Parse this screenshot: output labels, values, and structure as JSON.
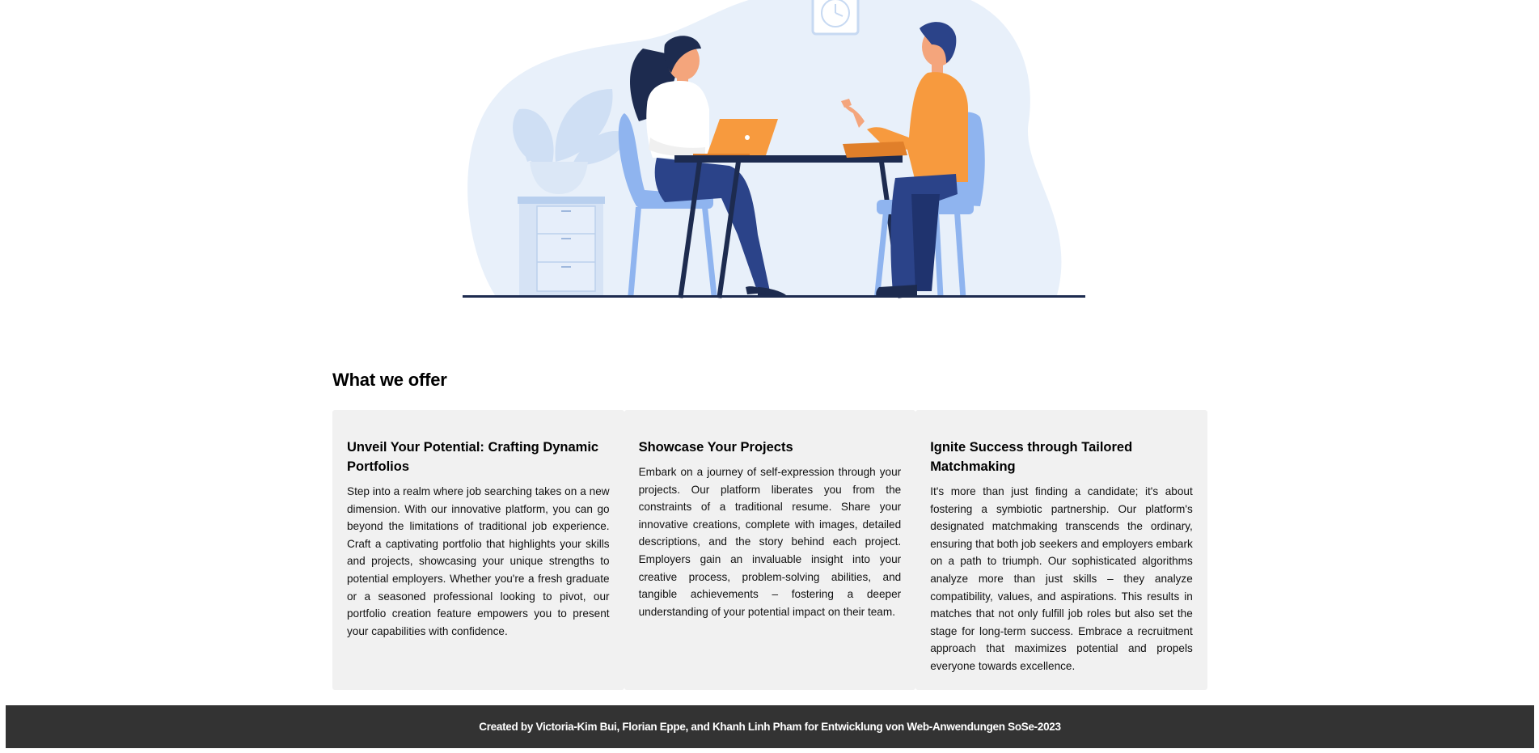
{
  "hero": {
    "illustration": "two-people-job-interview-illustration"
  },
  "offer": {
    "heading": "What we offer",
    "cards": [
      {
        "title": "Unveil Your Potential: Crafting Dynamic Portfolios",
        "body": "Step into a realm where job searching takes on a new dimension. With our innovative platform, you can go beyond the limitations of traditional job experience. Craft a captivating portfolio that highlights your skills and projects, showcasing your unique strengths to potential employers. Whether you're a fresh graduate or a seasoned professional looking to pivot, our portfolio creation feature empowers you to present your capabilities with confidence."
      },
      {
        "title": "Showcase Your Projects",
        "body": "Embark on a journey of self-expression through your projects. Our platform liberates you from the constraints of a traditional resume. Share your innovative creations, complete with images, detailed descriptions, and the story behind each project. Employers gain an invaluable insight into your creative process, problem-solving abilities, and tangible achievements – fostering a deeper understanding of your potential impact on their team."
      },
      {
        "title": "Ignite Success through Tailored Matchmaking",
        "body": "It's more than just finding a candidate; it's about fostering a symbiotic partnership. Our platform's designated matchmaking transcends the ordinary, ensuring that both job seekers and employers embark on a path to triumph. Our sophisticated algorithms analyze more than just skills – they analyze compatibility, values, and aspirations. This results in matches that not only fulfill job roles but also set the stage for long-term success. Embrace a recruitment approach that maximizes potential and propels everyone towards excellence."
      }
    ]
  },
  "footer": {
    "credit": "Created by Victoria-Kim Bui, Florian Eppe, and Khanh Linh Pham for Entwicklung von Web-Anwendungen SoSe-2023"
  },
  "colors": {
    "blob": "#e8f0fa",
    "plant": "#c9dbf2",
    "chair": "#8fb4ef",
    "navy": "#1d2b4f",
    "pants": "#2b4389",
    "orange": "#f79a3e",
    "skin": "#f4a57c",
    "footer_bg": "#333333",
    "card_bg": "#f1f1f1"
  }
}
